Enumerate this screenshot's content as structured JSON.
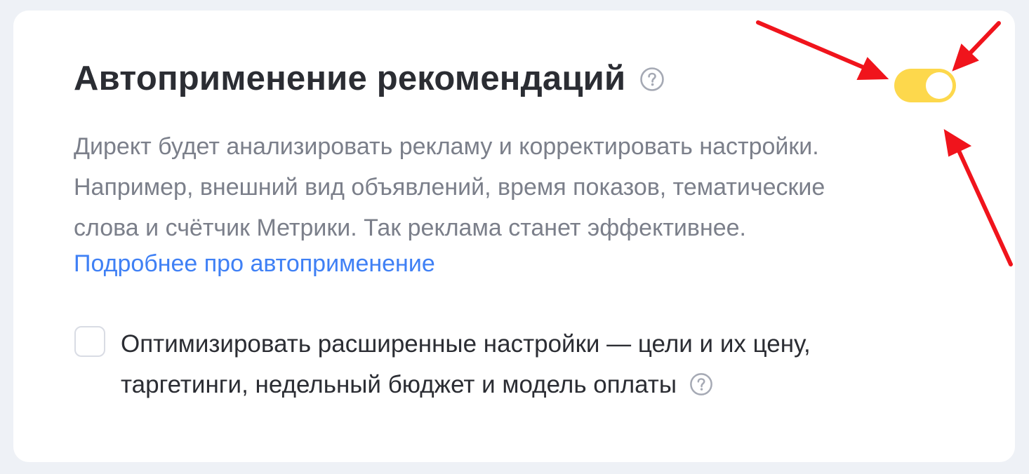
{
  "card": {
    "title": "Автоприменение рекомендаций",
    "toggle_state": "on",
    "description_lines": [
      "Директ будет анализировать рекламу и корректировать настройки.",
      "Например, внешний вид объявлений, время показов, тематические",
      "слова и счётчик Метрики. Так реклама станет эффективнее."
    ],
    "link_text": "Подробнее про автоприменение",
    "checkbox": {
      "checked": false,
      "label_lines": [
        "Оптимизировать расширенные настройки — цели и их цену,",
        "таргетинги, недельный бюджет и модель оплаты"
      ]
    }
  },
  "icons": {
    "title_help": "question-circle-icon",
    "checkbox_help": "question-circle-icon",
    "annotation": "red-arrow"
  },
  "colors": {
    "background": "#eef1f6",
    "card": "#ffffff",
    "toggle_on": "#fdd84c",
    "link": "#3f80f5",
    "title_text": "#2b2d33",
    "muted_text": "#7b7f8a",
    "arrow": "#f0141c"
  }
}
